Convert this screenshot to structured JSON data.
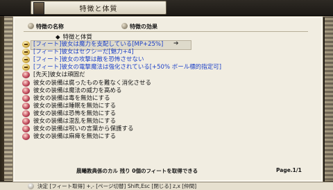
{
  "window": {
    "title": "特徴と体質"
  },
  "columns": {
    "name": "特徴の名称",
    "effect": "特徴の効果"
  },
  "section": {
    "label": "特徴と体質",
    "bullet": "◆"
  },
  "rows": [
    {
      "text": "[フィート]彼女は魔力を支配している[MP+25%]",
      "color": "blue",
      "icon": "gold",
      "selected": true
    },
    {
      "text": "[フィート]彼女はセクシーだ[魅力+4]",
      "color": "blue",
      "icon": "gold"
    },
    {
      "text": "[フィート]彼女の攻撃は敵を恐怖させない",
      "color": "blue",
      "icon": "gold"
    },
    {
      "text": "[フィート]彼女の電撃魔法は強化されている[+50% ボール標的指定可]",
      "color": "blue",
      "icon": "gold"
    },
    {
      "text": "[先天]彼女は頑固だ",
      "color": "black",
      "icon": "red"
    },
    {
      "text": "彼女の装備は腐ったものを難なく消化させる",
      "color": "black",
      "icon": "red"
    },
    {
      "text": "彼女の装備は魔法の威力を高める",
      "color": "black",
      "icon": "red"
    },
    {
      "text": "彼女の装備は毒を無効にする",
      "color": "black",
      "icon": "red"
    },
    {
      "text": "彼女の装備は睡眠を無効にする",
      "color": "black",
      "icon": "red"
    },
    {
      "text": "彼女の装備は恐怖を無効にする",
      "color": "black",
      "icon": "red"
    },
    {
      "text": "彼女の装備は混乱を無効にする",
      "color": "black",
      "icon": "red"
    },
    {
      "text": "彼女の装備は呪いの言葉から保護する",
      "color": "black",
      "icon": "red"
    },
    {
      "text": "彼女の装備は麻痺を無効にする",
      "color": "black",
      "icon": "red"
    }
  ],
  "cursor": "➔",
  "footer": {
    "status": "晨曦教典係のカル 残り 0個のフィートを取得できる",
    "page": "Page.1/1"
  },
  "help": "決定 [フィート取得]  +,- [ページ切替]  Shift,Esc [閉じる]  z,x [仲間]"
}
